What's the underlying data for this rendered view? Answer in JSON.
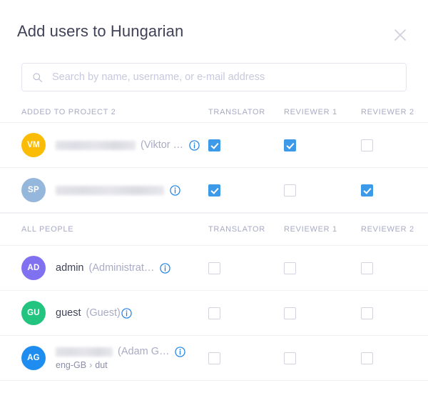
{
  "dialog": {
    "title": "Add users to Hungarian",
    "close_icon": "close-icon"
  },
  "search": {
    "icon": "search-icon",
    "placeholder": "Search by name, username, or e-mail address",
    "value": ""
  },
  "columns": {
    "translator": "TRANSLATOR",
    "reviewer1": "REVIEWER 1",
    "reviewer2": "REVIEWER 2"
  },
  "sections": [
    {
      "label": "ADDED TO PROJECT 2",
      "rows": [
        {
          "initials": "VM",
          "avatar_color": "#fbbc05",
          "username": "████████████",
          "username_redacted": true,
          "fullname": "(Viktor …",
          "info_icon": "info-icon",
          "langpair": "",
          "translator": true,
          "reviewer1": true,
          "reviewer2": false
        },
        {
          "initials": "SP",
          "avatar_color": "#94b7db",
          "username": "████████████████████",
          "username_redacted": true,
          "fullname": "",
          "info_icon": "info-icon",
          "langpair": "",
          "translator": true,
          "reviewer1": false,
          "reviewer2": true
        }
      ]
    },
    {
      "label": "ALL PEOPLE",
      "rows": [
        {
          "initials": "AD",
          "avatar_color": "#8071f0",
          "username": "admin",
          "username_redacted": false,
          "fullname": "(Administrat…",
          "info_icon": "info-icon",
          "langpair": "",
          "translator": false,
          "reviewer1": false,
          "reviewer2": false
        },
        {
          "initials": "GU",
          "avatar_color": "#22c47f",
          "username": "guest",
          "username_redacted": false,
          "fullname": "(Guest)",
          "info_icon": "info-icon",
          "langpair": "",
          "translator": false,
          "reviewer1": false,
          "reviewer2": false
        },
        {
          "initials": "AG",
          "avatar_color": "#1f8df0",
          "username": "█████████",
          "username_redacted": true,
          "fullname": "(Adam G…",
          "info_icon": "info-icon",
          "langpair_source": "eng-GB",
          "langpair_sep": "›",
          "langpair_target": "dut",
          "translator": false,
          "reviewer1": false,
          "reviewer2": false
        }
      ]
    }
  ],
  "colors": {
    "accent_checkbox": "#3c9ae8",
    "info_blue": "#1a82e8",
    "text_primary": "#3f4257",
    "text_muted": "#a9abc4",
    "border": "#f0f0f5"
  }
}
